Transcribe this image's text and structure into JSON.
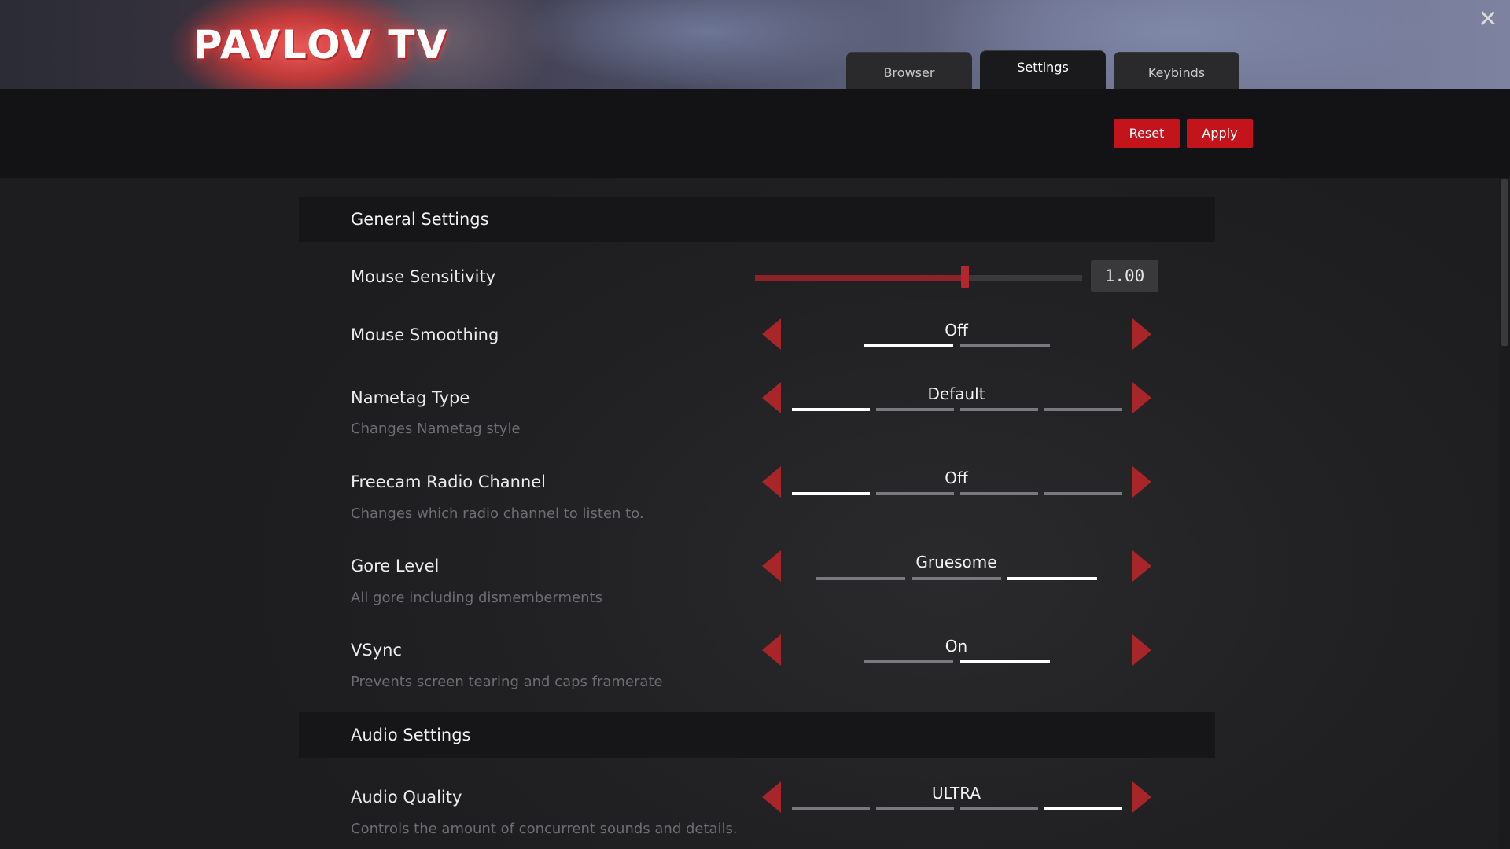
{
  "header": {
    "logo_text": "PAVLOV TV",
    "tabs": [
      {
        "label": "Browser",
        "active": false
      },
      {
        "label": "Settings",
        "active": true
      },
      {
        "label": "Keybinds",
        "active": false
      }
    ],
    "close_icon": "close-icon"
  },
  "toolbar": {
    "reset_label": "Reset",
    "apply_label": "Apply"
  },
  "colors": {
    "accent": "#c4141b",
    "arrow": "#a8262a",
    "slider_fill": "#8c2328"
  },
  "sections": {
    "general": {
      "title": "General Settings",
      "mouse_sensitivity": {
        "label": "Mouse Sensitivity",
        "value": "1.00",
        "fraction": 0.64
      },
      "mouse_smoothing": {
        "label": "Mouse Smoothing",
        "value": "Off",
        "segments": 2,
        "selected": 0
      },
      "nametag_type": {
        "label": "Nametag Type",
        "desc": "Changes Nametag style",
        "value": "Default",
        "segments": 4,
        "selected": 0
      },
      "freecam_radio": {
        "label": "Freecam Radio Channel",
        "desc": "Changes which radio channel to listen to.",
        "value": "Off",
        "segments": 4,
        "selected": 0
      },
      "gore_level": {
        "label": "Gore Level",
        "desc": "All gore including dismemberments",
        "value": "Gruesome",
        "segments": 3,
        "selected": 2
      },
      "vsync": {
        "label": "VSync",
        "desc": "Prevents screen tearing and caps framerate",
        "value": "On",
        "segments": 2,
        "selected": 1
      }
    },
    "audio": {
      "title": "Audio Settings",
      "audio_quality": {
        "label": "Audio Quality",
        "desc": "Controls the amount of concurrent sounds and details.",
        "value": "ULTRA",
        "segments": 4,
        "selected": 3
      }
    }
  }
}
